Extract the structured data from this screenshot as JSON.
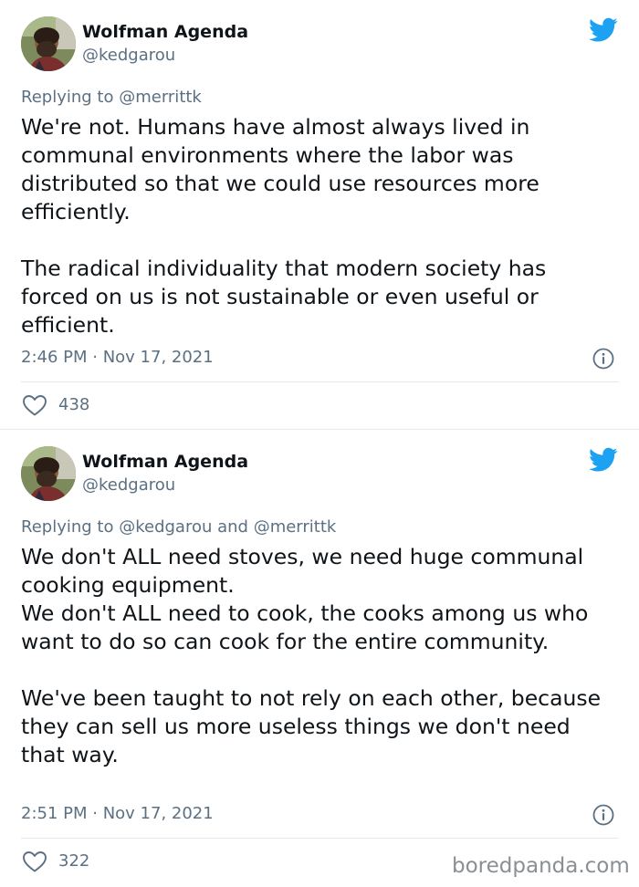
{
  "tweets": [
    {
      "author": {
        "display_name": "Wolfman Agenda",
        "handle": "@kedgarou",
        "avatar_icon": "avatar-photo"
      },
      "replying_to": {
        "prefix": "Replying to",
        "mentions": "@merrittk"
      },
      "paragraphs": [
        "We're not. Humans have almost always lived in communal environments where the labor was distributed so that we could use resources more efficiently.",
        "The radical individuality that modern society has forced on us is not sustainable or even useful or efficient."
      ],
      "timestamp": "2:46 PM · Nov 17, 2021",
      "likes": "438"
    },
    {
      "author": {
        "display_name": "Wolfman Agenda",
        "handle": "@kedgarou",
        "avatar_icon": "avatar-photo"
      },
      "replying_to": {
        "prefix": "Replying to",
        "mentions": "@kedgarou and @merrittk"
      },
      "paragraphs": [
        "We don't ALL need stoves, we need huge communal cooking equipment.\nWe don't ALL need to cook, the cooks among us who want to do so can cook for the entire community.",
        "We've been taught to not rely on each other, because they can sell us more useless things we don't need that way."
      ],
      "timestamp": "2:51 PM · Nov 17, 2021",
      "likes": "322"
    }
  ],
  "icons": {
    "brand": "twitter-bird-icon",
    "info": "info-icon",
    "like": "heart-icon"
  },
  "colors": {
    "twitter_blue": "#1da1f2",
    "secondary_text": "#5b7083",
    "primary_text": "#0f1419"
  },
  "watermark": "boredpanda.com"
}
